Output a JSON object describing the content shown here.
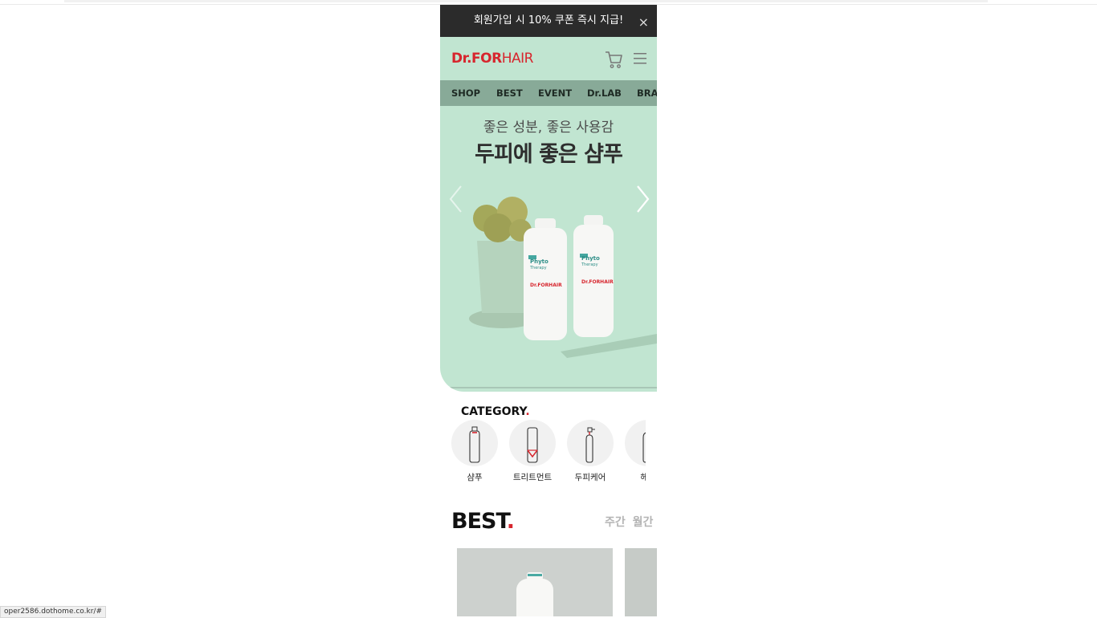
{
  "promo": {
    "text": "회원가입 시 10% 쿠폰 즉시 지급!",
    "close_label": "×"
  },
  "header": {
    "logo_bold": "Dr.FOR",
    "logo_regular": "HAIR",
    "cart_icon": "cart-icon",
    "menu_icon": "hamburger-menu-icon"
  },
  "nav": {
    "items": [
      {
        "label": "SHOP"
      },
      {
        "label": "BEST"
      },
      {
        "label": "EVENT"
      },
      {
        "label": "Dr.LAB"
      },
      {
        "label": "BRAN"
      }
    ]
  },
  "banner": {
    "subtitle": "좋은 성분, 좋은 사용감",
    "title": "두피에 좋은 샴푸",
    "prev_icon": "chevron-left-icon",
    "next_icon": "chevron-right-icon",
    "bottle_brand": "Dr.FORHAIR",
    "bottle_line": "Phyto",
    "bottle_sub": "Therapy"
  },
  "category": {
    "title": "CATEGORY",
    "title_dot": ".",
    "items": [
      {
        "label": "샴푸",
        "icon": "shampoo-bottle-icon"
      },
      {
        "label": "트리트먼트",
        "icon": "treatment-tube-icon"
      },
      {
        "label": "두피케어",
        "icon": "spray-bottle-icon"
      },
      {
        "label": "헤어",
        "icon": "hair-care-bottle-icon"
      }
    ]
  },
  "best": {
    "title": "BEST",
    "title_dot": ".",
    "tabs": [
      "주간",
      "월간"
    ]
  },
  "status_bar": {
    "url": "oper2586.dothome.co.kr/#"
  },
  "colors": {
    "brand_red": "#d7262e",
    "mint": "#c1e5d1",
    "nav_green": "#88aa98",
    "promo_bg": "#2b2b2b"
  }
}
